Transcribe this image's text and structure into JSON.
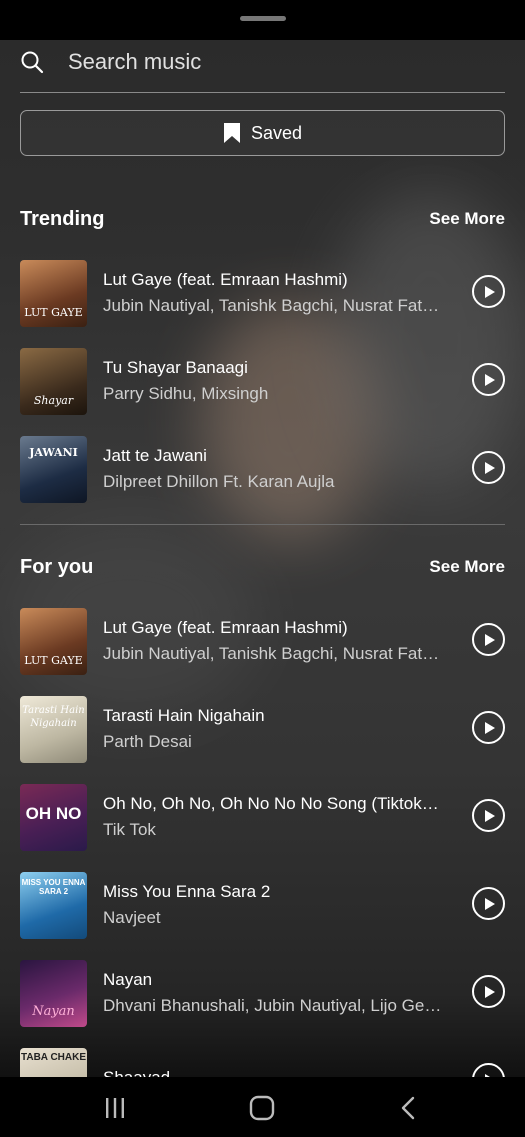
{
  "search": {
    "placeholder": "Search music"
  },
  "saved_button": {
    "label": "Saved",
    "icon": "bookmark-icon"
  },
  "trending": {
    "title": "Trending",
    "see_more": "See More",
    "items": [
      {
        "title": "Lut Gaye (feat. Emraan Hashmi)",
        "artist": "Jubin Nautiyal, Tanishk Bagchi, Nusrat Fateh Ali Khan",
        "thumb_text": "LUT GAYE",
        "thumb_colors": [
          "#6b3a22",
          "#c98b5a"
        ]
      },
      {
        "title": "Tu Shayar Banaagi",
        "artist": "Parry Sidhu, Mixsingh",
        "thumb_text": "Shayar",
        "thumb_colors": [
          "#3a2a1c",
          "#8a6a44"
        ]
      },
      {
        "title": "Jatt te Jawani",
        "artist": "Dilpreet Dhillon Ft. Karan Aujla",
        "thumb_text": "JAWANI",
        "thumb_colors": [
          "#1d2c44",
          "#6a7a8e"
        ]
      }
    ]
  },
  "for_you": {
    "title": "For you",
    "see_more": "See More",
    "items": [
      {
        "title": "Lut Gaye (feat. Emraan Hashmi)",
        "artist": "Jubin Nautiyal, Tanishk Bagchi, Nusrat Fateh Ali Khan",
        "thumb_text": "LUT GAYE",
        "thumb_colors": [
          "#6b3a22",
          "#c98b5a"
        ]
      },
      {
        "title": "Tarasti Hain Nigahain",
        "artist": "Parth Desai",
        "thumb_text": "Tarasti Hain Nigahain",
        "thumb_colors": [
          "#d8d2c0",
          "#8f8a78"
        ]
      },
      {
        "title": "Oh No, Oh No, Oh No No No Song (Tiktok Remix)",
        "artist": "Tik Tok",
        "thumb_text": "OH NO",
        "thumb_colors": [
          "#7a2a55",
          "#2a1a4a"
        ]
      },
      {
        "title": "Miss You Enna Sara 2",
        "artist": "Navjeet",
        "thumb_text": "MISS YOU ENNA SARA 2",
        "thumb_colors": [
          "#1f6aa8",
          "#8fd0f0"
        ]
      },
      {
        "title": "Nayan",
        "artist": "Dhvani Bhanushali, Jubin Nautiyal, Lijo George",
        "thumb_text": "Nayan",
        "thumb_colors": [
          "#2a1540",
          "#c04a8a"
        ]
      },
      {
        "title": "Shaayad",
        "artist": "",
        "thumb_text": "TABA CHAKE",
        "thumb_colors": [
          "#e8e0d0",
          "#b0a890"
        ]
      }
    ]
  },
  "navbar": {
    "recents_icon": "recents-icon",
    "home_icon": "home-icon",
    "back_icon": "back-icon"
  }
}
